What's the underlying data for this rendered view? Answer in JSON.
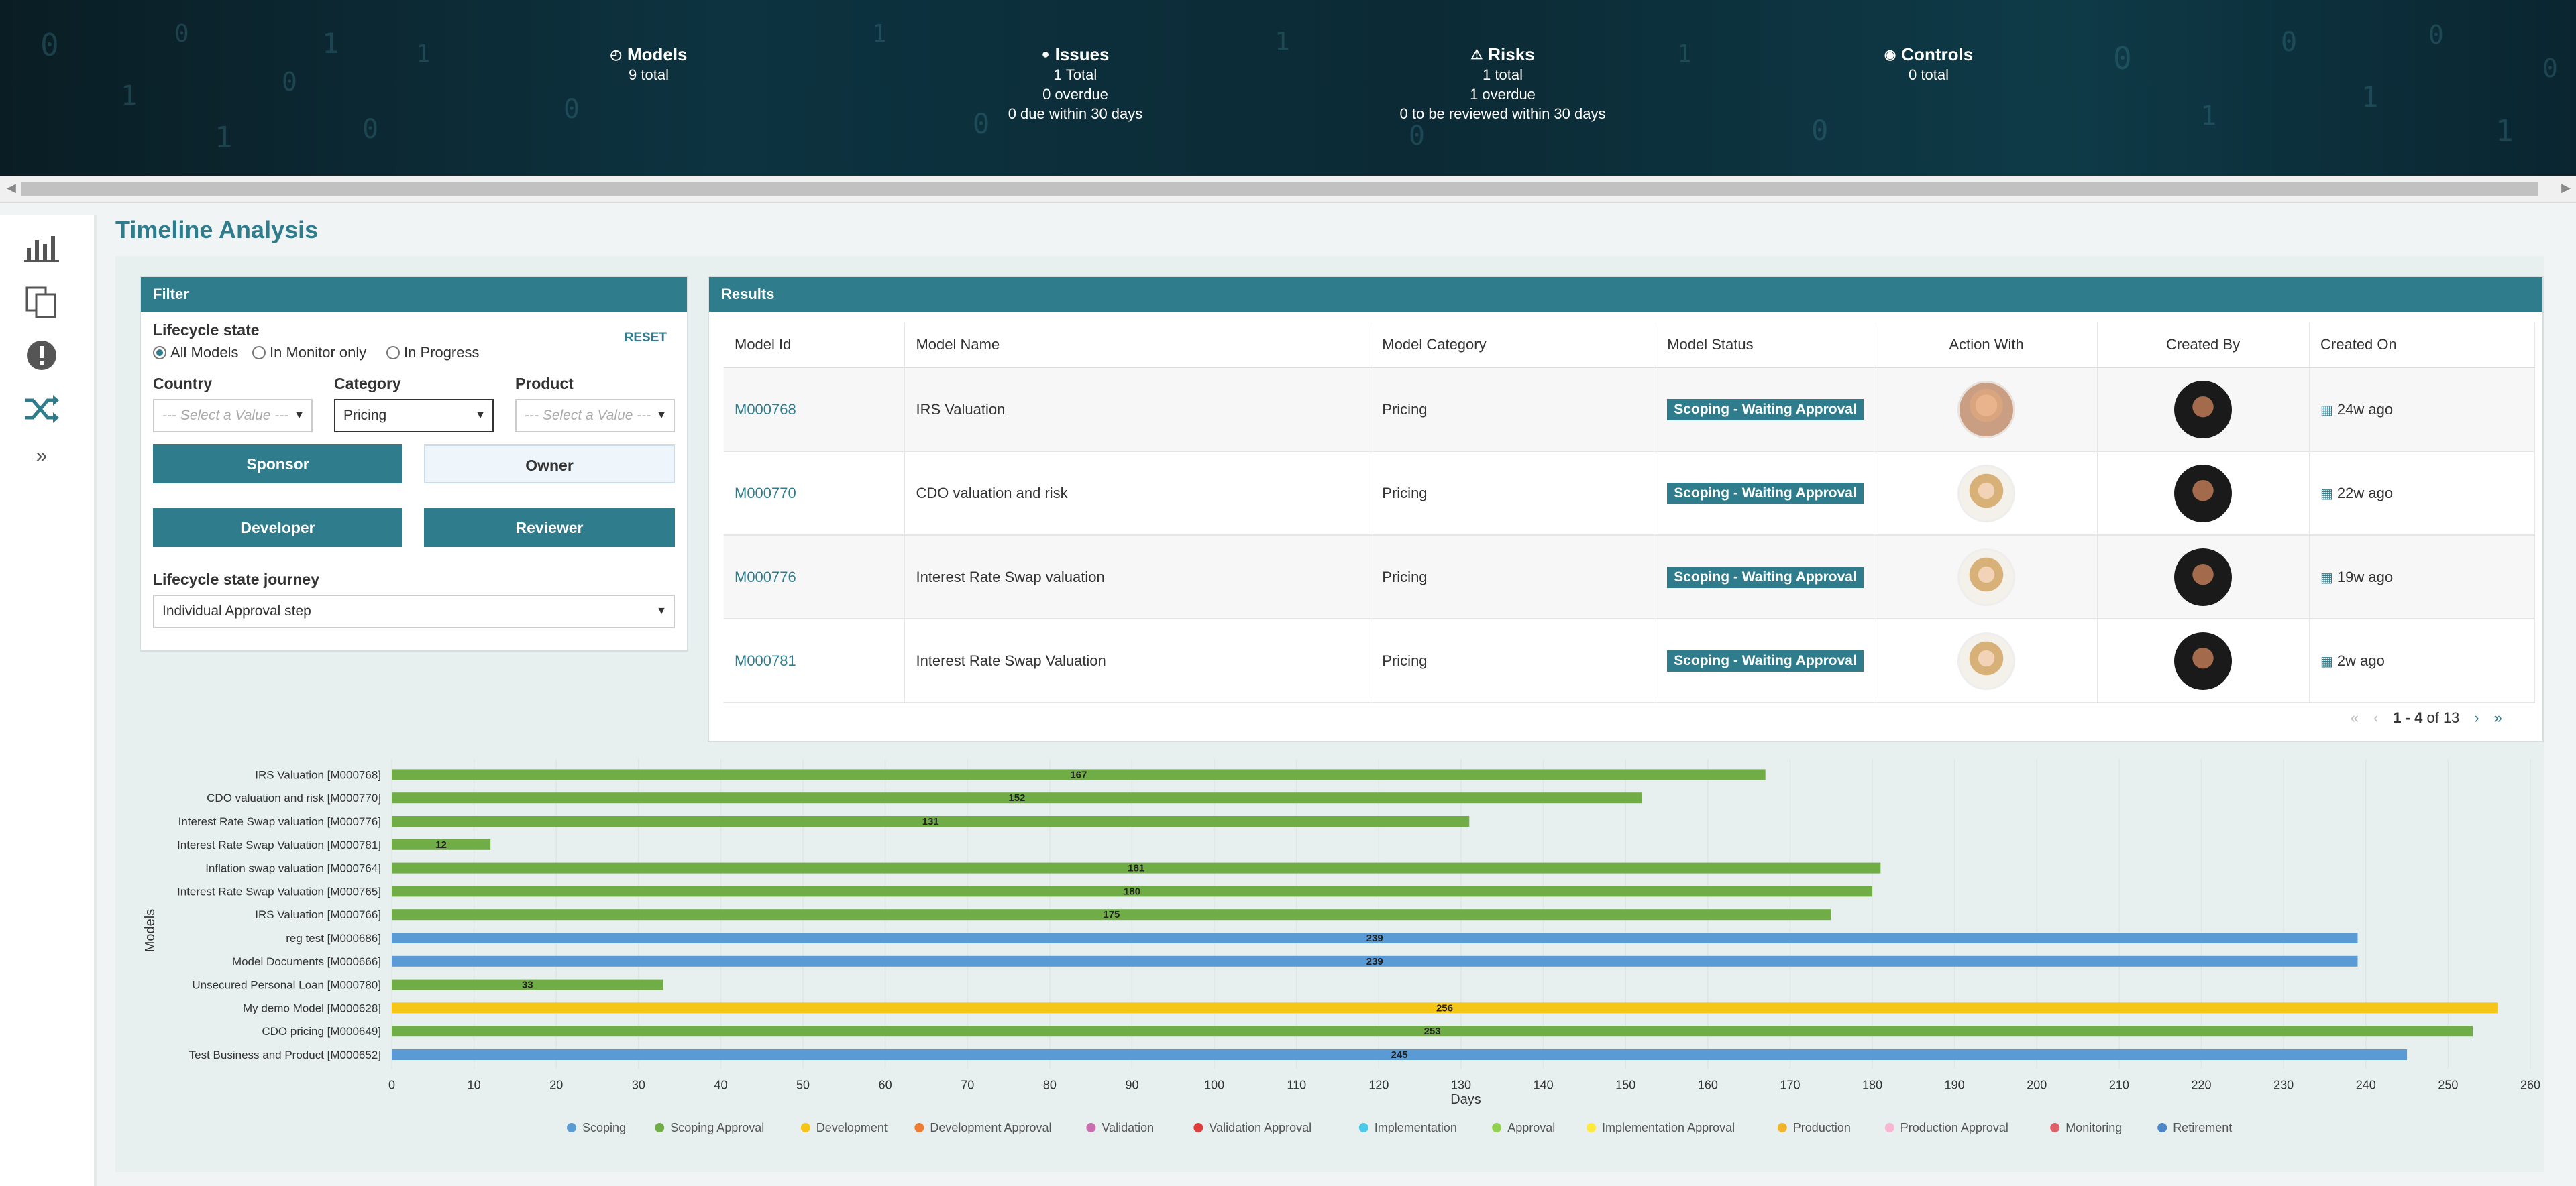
{
  "header": {
    "models": {
      "title": "Models",
      "lines": [
        "9 total"
      ]
    },
    "issues": {
      "title": "Issues",
      "lines": [
        "1 Total",
        "0 overdue",
        "0 due within 30 days"
      ]
    },
    "risks": {
      "title": "Risks",
      "lines": [
        "1 total",
        "1 overdue",
        "0 to be reviewed within 30 days"
      ]
    },
    "controls": {
      "title": "Controls",
      "lines": [
        "0 total"
      ]
    }
  },
  "nav": {
    "icons": [
      "bar-chart-icon",
      "documents-icon",
      "alert-icon",
      "shuffle-icon",
      "expand-chevron-icon"
    ],
    "active": "shuffle-icon"
  },
  "page_title": "Timeline Analysis",
  "filter": {
    "header": "Filter",
    "lifecycle_label": "Lifecycle state",
    "reset": "RESET",
    "radios": [
      {
        "label": "All Models",
        "checked": true
      },
      {
        "label": "In Monitor only",
        "checked": false
      },
      {
        "label": "In Progress",
        "checked": false
      }
    ],
    "country": {
      "label": "Country",
      "value": "--- Select a Value ---"
    },
    "category": {
      "label": "Category",
      "value": "Pricing"
    },
    "product": {
      "label": "Product",
      "value": "--- Select a Value ---"
    },
    "buttons": {
      "sponsor": "Sponsor",
      "owner": "Owner",
      "developer": "Developer",
      "reviewer": "Reviewer"
    },
    "journey_label": "Lifecycle state journey",
    "journey_value": "Individual Approval step"
  },
  "results": {
    "header": "Results",
    "columns": [
      "Model Id",
      "Model Name",
      "Model Category",
      "Model Status",
      "Action With",
      "Created By",
      "Created On"
    ],
    "rows": [
      {
        "id": "M000768",
        "name": "IRS Valuation",
        "category": "Pricing",
        "status": "Scoping - Waiting Approval",
        "created_on": "24w ago"
      },
      {
        "id": "M000770",
        "name": "CDO valuation and risk",
        "category": "Pricing",
        "status": "Scoping - Waiting Approval",
        "created_on": "22w ago"
      },
      {
        "id": "M000776",
        "name": "Interest Rate Swap valuation",
        "category": "Pricing",
        "status": "Scoping - Waiting Approval",
        "created_on": "19w ago"
      },
      {
        "id": "M000781",
        "name": "Interest Rate Swap Valuation",
        "category": "Pricing",
        "status": "Scoping - Waiting Approval",
        "created_on": "2w ago"
      }
    ],
    "pagination": {
      "range": "1 - 4",
      "of_label": "of 13"
    }
  },
  "colors": {
    "accent": "#2e7c8c",
    "scoping": "#5b9bd5",
    "scoping_approval": "#70ad47",
    "development": "#f5c518"
  },
  "chart_data": {
    "type": "bar",
    "orientation": "horizontal",
    "ylabel": "Models",
    "xlabel": "Days",
    "xlim": [
      0,
      260
    ],
    "xticks": [
      0,
      10,
      20,
      30,
      40,
      50,
      60,
      70,
      80,
      90,
      100,
      110,
      120,
      130,
      140,
      150,
      160,
      170,
      180,
      190,
      200,
      210,
      220,
      230,
      240,
      250,
      260
    ],
    "grid": true,
    "legend_placement": "bottom",
    "categories": [
      "IRS Valuation [M000768]",
      "CDO valuation and risk [M000770]",
      "Interest Rate Swap valuation [M000776]",
      "Interest Rate Swap Valuation [M000781]",
      "Inflation swap valuation [M000764]",
      "Interest Rate Swap Valuation [M000765]",
      "IRS Valuation [M000766]",
      "reg test [M000686]",
      "Model Documents [M000666]",
      "Unsecured Personal Loan [M000780]",
      "My demo Model [M000628]",
      "CDO pricing [M000649]",
      "Test Business and Product [M000652]"
    ],
    "values": [
      167,
      152,
      131,
      12,
      181,
      180,
      175,
      239,
      239,
      33,
      256,
      253,
      245
    ],
    "bar_series": [
      "Scoping Approval",
      "Scoping Approval",
      "Scoping Approval",
      "Scoping Approval",
      "Scoping Approval",
      "Scoping Approval",
      "Scoping Approval",
      "Scoping",
      "Scoping",
      "Scoping Approval",
      "Development",
      "Scoping Approval",
      "Scoping"
    ],
    "legend": [
      {
        "name": "Scoping",
        "color": "#5b9bd5"
      },
      {
        "name": "Scoping Approval",
        "color": "#70ad47"
      },
      {
        "name": "Development",
        "color": "#f5c518"
      },
      {
        "name": "Development Approval",
        "color": "#ed7d31"
      },
      {
        "name": "Validation",
        "color": "#c86dae"
      },
      {
        "name": "Validation Approval",
        "color": "#e03c3c"
      },
      {
        "name": "Implementation",
        "color": "#4cc9e8"
      },
      {
        "name": "Approval",
        "color": "#92d050"
      },
      {
        "name": "Implementation Approval",
        "color": "#ffe93b"
      },
      {
        "name": "Production",
        "color": "#f0b429"
      },
      {
        "name": "Production Approval",
        "color": "#f7b6d2"
      },
      {
        "name": "Monitoring",
        "color": "#e0606a"
      },
      {
        "name": "Retirement",
        "color": "#4a86c8"
      }
    ]
  }
}
